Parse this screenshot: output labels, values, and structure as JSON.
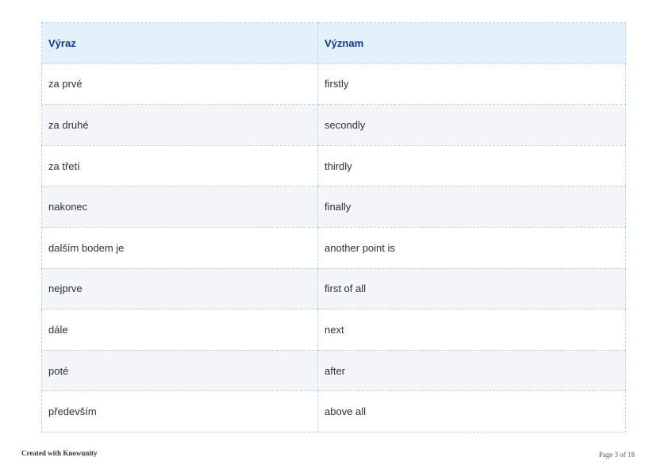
{
  "table": {
    "headers": [
      "Výraz",
      "Význam"
    ],
    "rows": [
      [
        "za prvé",
        "firstly"
      ],
      [
        "za druhé",
        "secondly"
      ],
      [
        "za třetí",
        "thirdly"
      ],
      [
        "nakonec",
        "finally"
      ],
      [
        "dalším bodem je",
        "another point is"
      ],
      [
        "nejprve",
        "first of all"
      ],
      [
        "dále",
        "next"
      ],
      [
        "poté",
        "after"
      ],
      [
        "především",
        "above all"
      ]
    ]
  },
  "footer": {
    "credit": "Created with Knowunity",
    "page": "Page 3 of 18"
  }
}
